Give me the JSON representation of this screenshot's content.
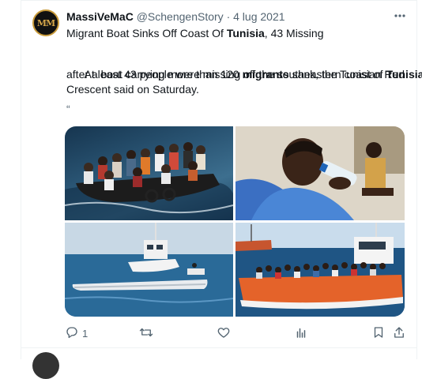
{
  "tweet": {
    "display_name": "MassiVeMaC",
    "handle": "@SchengenStory",
    "separator": "·",
    "date": "4 lug 2021",
    "avatar_text": "MM",
    "headline_pre": "Migrant Boat Sinks Off Coast Of ",
    "headline_bold": "Tunisia",
    "headline_post": ", 43 Missing",
    "body_line1_pre": "  At least 43 people were missing off the southeastern coast of ",
    "body_line1_bold": "Tunisia",
    "body_line2_pre": "after a boat carrying more than 120 ",
    "body_line2_bold": "migrants",
    "body_line2_post": " sank, the Tunisian Red",
    "body_line3": "Crescent said on Saturday.",
    "quote_mark": "“"
  },
  "actions": {
    "reply_count": "1"
  },
  "icons": {
    "more": "more-icon",
    "reply": "reply-icon",
    "retweet": "retweet-icon",
    "like": "heart-icon",
    "views": "views-icon",
    "bookmark": "bookmark-icon",
    "share": "share-icon"
  },
  "colors": {
    "text": "#0f1419",
    "secondary": "#536471",
    "divider": "#eff3f4",
    "avatar_gold": "#c89a3a"
  }
}
